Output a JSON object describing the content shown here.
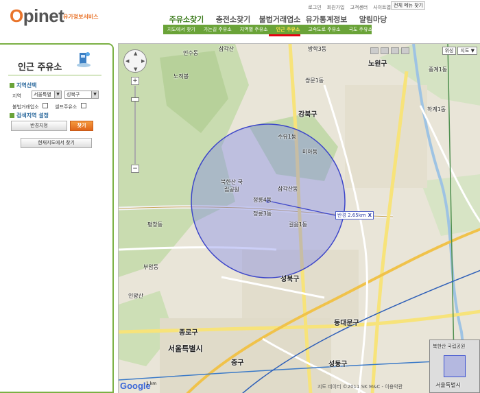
{
  "header": {
    "logo_o": "O",
    "logo_rest": "pinet",
    "logo_sub": "유가정보서비스",
    "util_links": [
      "로그인",
      "회원가입",
      "고객센터",
      "사이트맵"
    ],
    "menu_find": "전체 메뉴 찾기",
    "gnb": [
      "주유소찾기",
      "충전소찾기",
      "불법거래업소",
      "유가통계정보",
      "알림마당"
    ],
    "snb": [
      "지도에서 찾기",
      "가는길 주유소",
      "지역별 주유소",
      "인근 주유소",
      "고속도로 주유소",
      "국도 주유소"
    ]
  },
  "side": {
    "title": "인근 주유소",
    "sec_area": "지역선택",
    "label_region": "지역",
    "sido": "서울특별",
    "gu": "성북구",
    "label_illegal": "불법거래업소",
    "label_self": "셀프주유소",
    "sec_search": "검색지역 설정",
    "btn_radius": "반경지정",
    "btn_search": "찾기",
    "btn_current": "현재지도에서 찾기"
  },
  "map": {
    "type_options": [
      "위성",
      "지도"
    ],
    "radius_label": "반경 2.65km",
    "radius_close": "X",
    "copyright": "지도 데이터 ©2011 SK M&C - 이용약관",
    "google": "Google",
    "scale": "1 km",
    "overview_label": "북한산 국립공원",
    "overview_label2": "서울특별시",
    "labels": [
      {
        "t": "삼각산",
        "big": false
      },
      {
        "t": "노원구",
        "big": true
      },
      {
        "t": "중계1동",
        "big": false
      },
      {
        "t": "강북구",
        "big": true
      },
      {
        "t": "북한산 국립공원",
        "big": false
      },
      {
        "t": "삼각산동",
        "big": false
      },
      {
        "t": "정릉4동",
        "big": false
      },
      {
        "t": "정릉3동",
        "big": false
      },
      {
        "t": "길음1동",
        "big": false
      },
      {
        "t": "미아동",
        "big": false
      },
      {
        "t": "수유1동",
        "big": false
      },
      {
        "t": "성북구",
        "big": true
      },
      {
        "t": "평창동",
        "big": false
      },
      {
        "t": "부암동",
        "big": false
      },
      {
        "t": "인왕산",
        "big": false
      },
      {
        "t": "종로구",
        "big": true
      },
      {
        "t": "서울특별시",
        "big": true
      },
      {
        "t": "중구",
        "big": true
      },
      {
        "t": "동대문구",
        "big": true
      },
      {
        "t": "성동구",
        "big": true
      },
      {
        "t": "방학3동",
        "big": false
      },
      {
        "t": "쌍문1동",
        "big": false
      },
      {
        "t": "하계1동",
        "big": false
      },
      {
        "t": "인수동",
        "big": false
      },
      {
        "t": "노적봉",
        "big": false
      }
    ]
  }
}
